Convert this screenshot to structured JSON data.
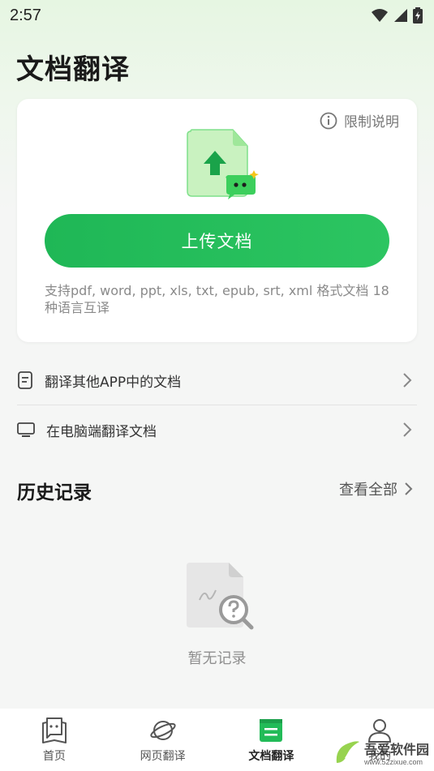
{
  "status_bar": {
    "time": "2:57"
  },
  "page_title": "文档翻译",
  "upload_card": {
    "limit_label": "限制说明",
    "upload_button": "上传文档",
    "formats_text": "支持pdf, word, ppt, xls, txt, epub, srt, xml 格式文档 18种语言互译"
  },
  "options": [
    {
      "label": "翻译其他APP中的文档",
      "icon": "document-icon"
    },
    {
      "label": "在电脑端翻译文档",
      "icon": "monitor-icon"
    }
  ],
  "history": {
    "title": "历史记录",
    "view_all": "查看全部",
    "empty_text": "暂无记录"
  },
  "bottom_nav": [
    {
      "label": "首页",
      "icon": "chat-book-icon",
      "active": false
    },
    {
      "label": "网页翻译",
      "icon": "planet-icon",
      "active": false
    },
    {
      "label": "文档翻译",
      "icon": "doc-translate-icon",
      "active": true
    },
    {
      "label": "我的",
      "icon": "profile-icon",
      "active": false
    }
  ],
  "watermark": {
    "title": "吾爱软件园",
    "url": "www.52zixue.com"
  },
  "colors": {
    "accent": "#22bb58",
    "background": "#f5f6f5"
  }
}
